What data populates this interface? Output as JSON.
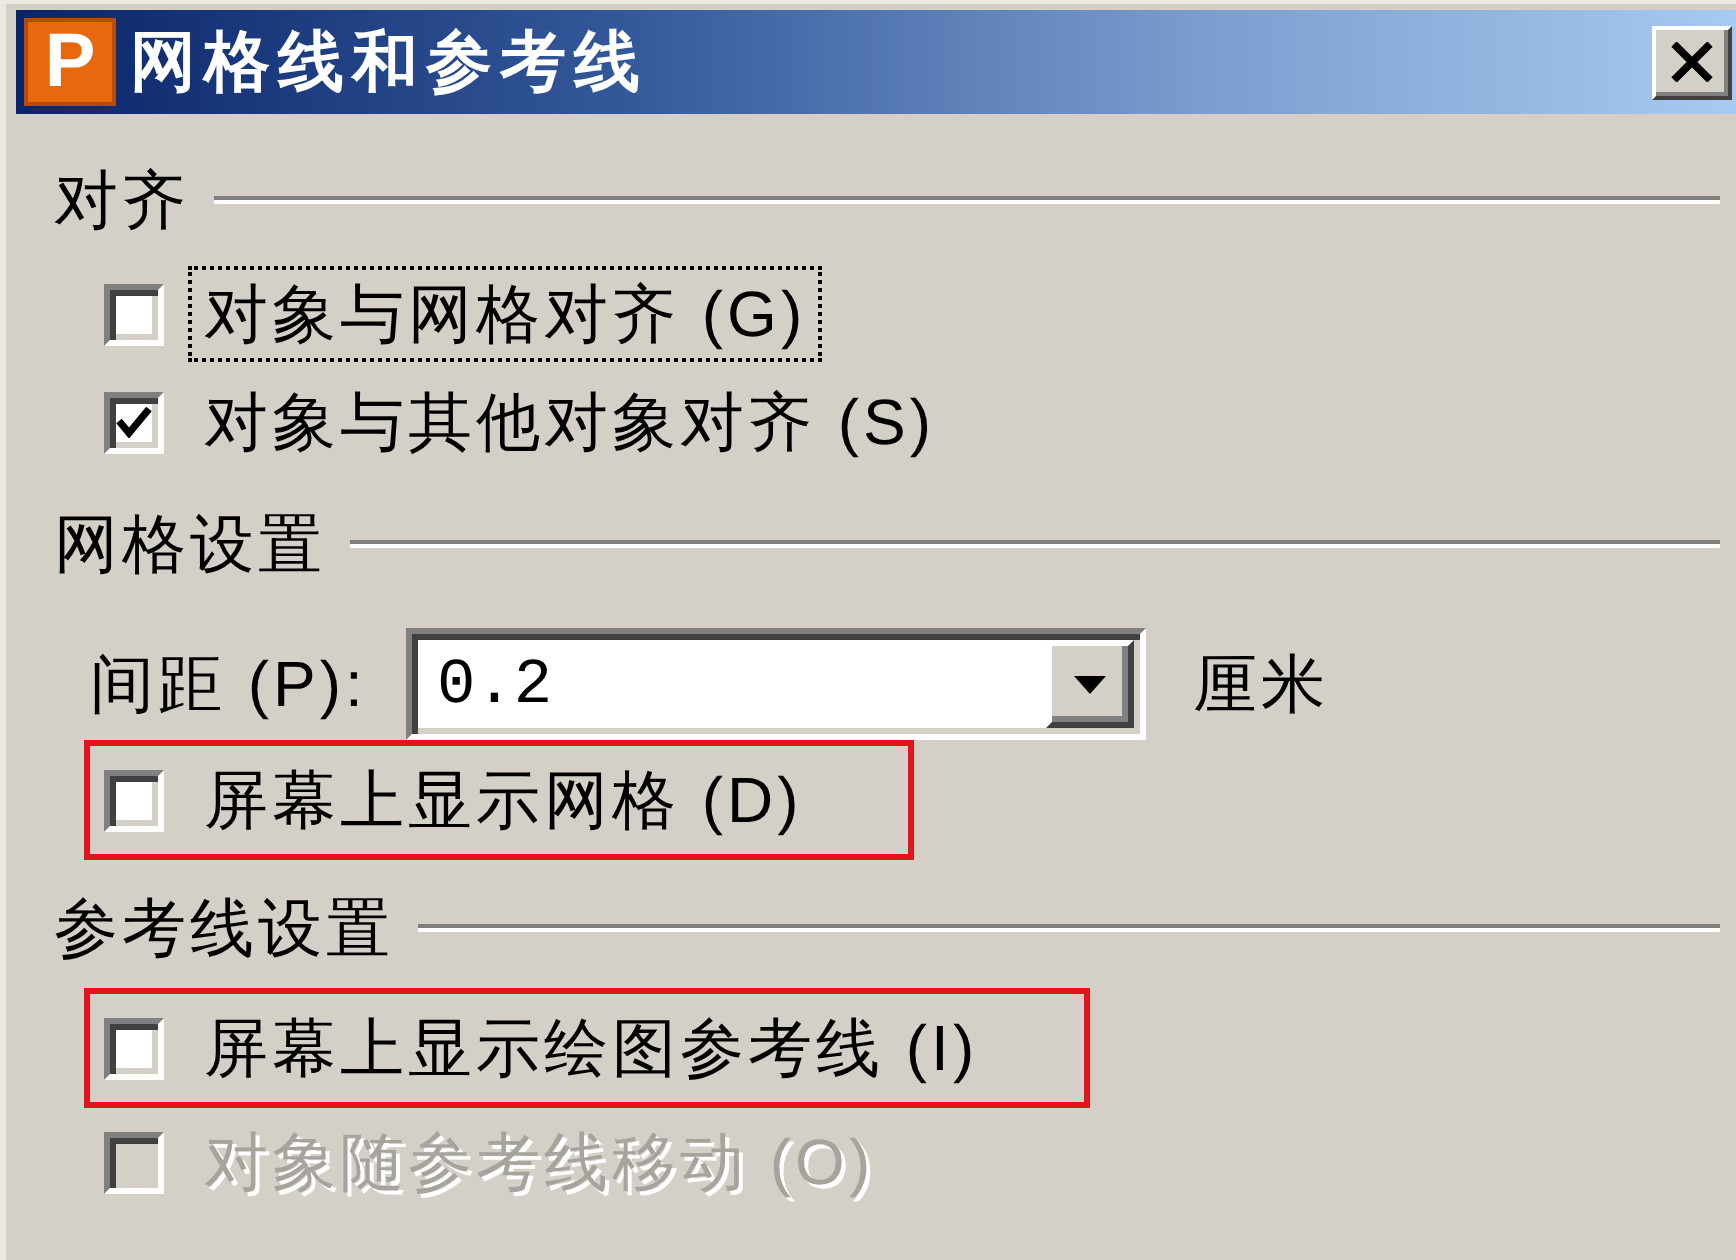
{
  "window": {
    "icon_text": "P",
    "title": "网格线和参考线"
  },
  "sections": [
    {
      "heading": "对齐",
      "items": [
        {
          "kind": "checkbox",
          "label": "对象与网格对齐 (G)",
          "checked": false,
          "disabled": false,
          "focused": true,
          "highlighted": false
        },
        {
          "kind": "checkbox",
          "label": "对象与其他对象对齐 (S)",
          "checked": true,
          "disabled": false,
          "focused": false,
          "highlighted": false
        }
      ]
    },
    {
      "heading": "网格设置",
      "items": [
        {
          "kind": "combo",
          "label": "间距 (P):",
          "value": "0.2",
          "unit": "厘米"
        },
        {
          "kind": "checkbox",
          "label": "屏幕上显示网格 (D)",
          "checked": false,
          "disabled": false,
          "focused": false,
          "highlighted": true
        }
      ]
    },
    {
      "heading": "参考线设置",
      "items": [
        {
          "kind": "checkbox",
          "label": "屏幕上显示绘图参考线 (I)",
          "checked": false,
          "disabled": false,
          "focused": false,
          "highlighted": true
        },
        {
          "kind": "checkbox",
          "label": "对象随参考线移动 (O)",
          "checked": false,
          "disabled": true,
          "focused": false,
          "highlighted": false
        }
      ]
    }
  ]
}
